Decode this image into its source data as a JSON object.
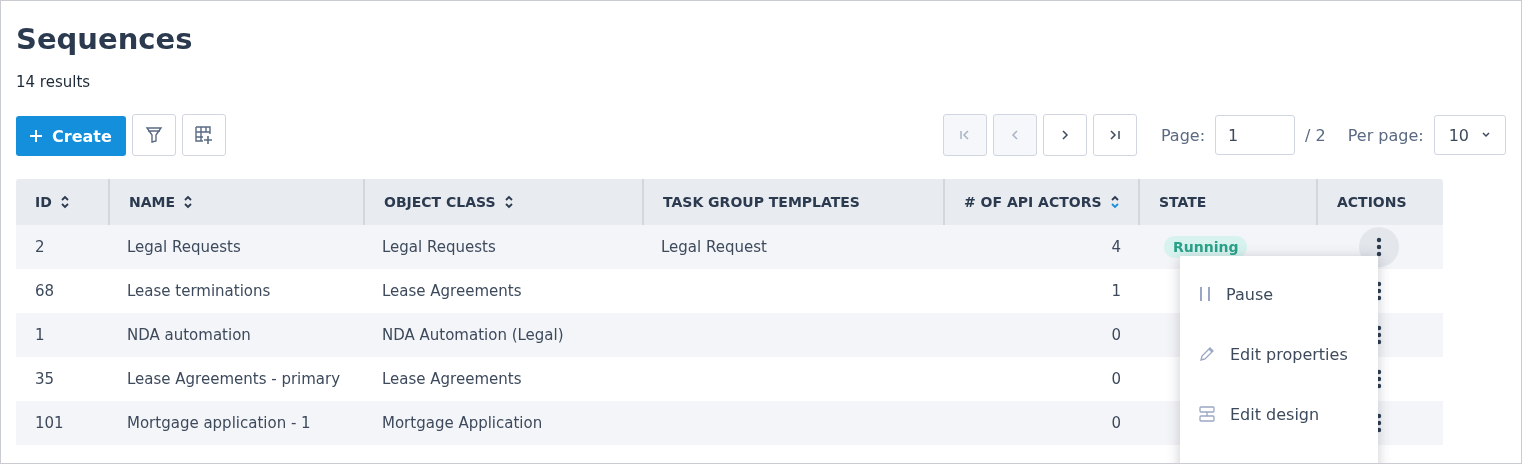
{
  "title": "Sequences",
  "result_count": "14 results",
  "toolbar": {
    "create_label": "Create"
  },
  "pagination": {
    "buttons": [
      {
        "kind": "first",
        "disabled": true
      },
      {
        "kind": "prev",
        "disabled": true
      },
      {
        "kind": "next",
        "disabled": false
      },
      {
        "kind": "last",
        "disabled": false
      }
    ],
    "page_label": "Page:",
    "page_value": "1",
    "page_total": "/ 2",
    "per_page_label": "Per page:",
    "per_page_value": "10"
  },
  "table": {
    "columns": [
      {
        "label": "ID",
        "sorted": false
      },
      {
        "label": "NAME",
        "sorted": false
      },
      {
        "label": "OBJECT CLASS",
        "sorted": false
      },
      {
        "label": "TASK GROUP TEMPLATES"
      },
      {
        "label": "# OF API ACTORS",
        "sorted": true
      },
      {
        "label": "STATE"
      },
      {
        "label": "ACTIONS"
      }
    ],
    "rows": [
      {
        "id": "2",
        "name": "Legal Requests",
        "object_class": "Legal Requests",
        "task_group_templates": "Legal Request",
        "api_actors": "4",
        "state": "Running",
        "menu_open": true
      },
      {
        "id": "68",
        "name": "Lease terminations",
        "object_class": "Lease Agreements",
        "api_actors": "1",
        "menu_open": false
      },
      {
        "id": "1",
        "name": "NDA automation",
        "object_class": "NDA Automation (Legal)",
        "api_actors": "0",
        "menu_open": false
      },
      {
        "id": "35",
        "name": "Lease Agreements - primary",
        "object_class": "Lease Agreements",
        "api_actors": "0",
        "menu_open": false
      },
      {
        "id": "101",
        "name": "Mortgage application - 1",
        "object_class": "Mortgage Application",
        "api_actors": "0",
        "menu_open": false
      }
    ]
  },
  "action_menu": {
    "items": [
      {
        "kind": "pause",
        "label": "Pause"
      },
      {
        "kind": "edit",
        "label": "Edit properties"
      },
      {
        "kind": "design",
        "label": "Edit design"
      }
    ]
  }
}
